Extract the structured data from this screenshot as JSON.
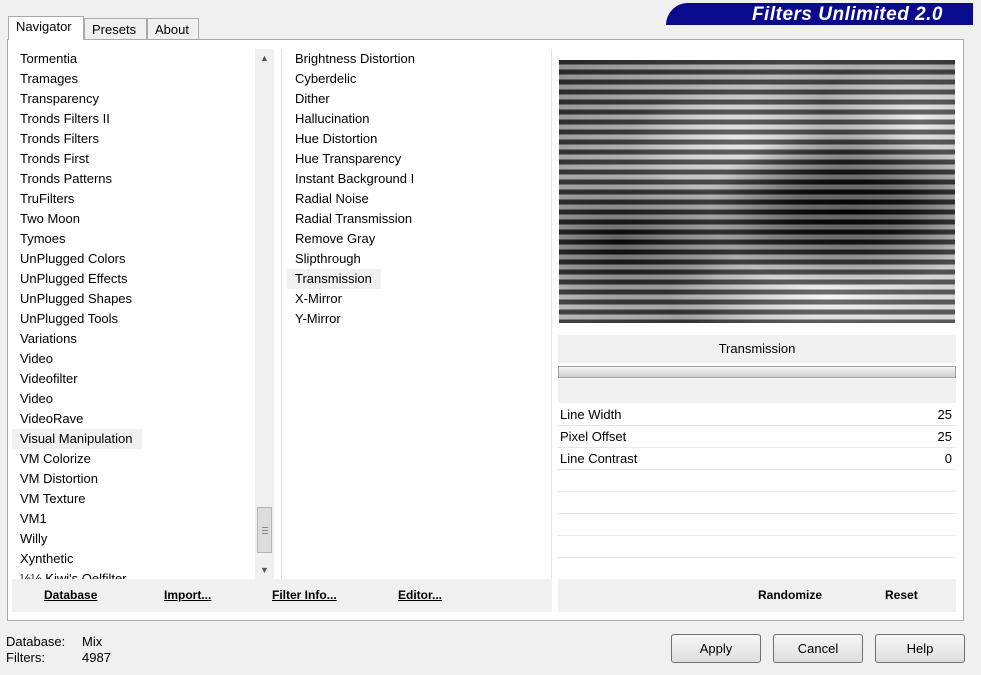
{
  "tabs": [
    {
      "label": "Navigator"
    },
    {
      "label": "Presets"
    },
    {
      "label": "About"
    }
  ],
  "logo": {
    "text": "Filters Unlimited 2.0"
  },
  "categories": {
    "items": [
      "Tormentia",
      "Tramages",
      "Transparency",
      "Tronds Filters II",
      "Tronds Filters",
      "Tronds First",
      "Tronds Patterns",
      "TruFilters",
      "Two Moon",
      "Tymoes",
      "UnPlugged Colors",
      "UnPlugged Effects",
      "UnPlugged Shapes",
      "UnPlugged Tools",
      "Variations",
      "Video",
      "Videofilter",
      "Video",
      "VideoRave",
      "Visual Manipulation",
      "VM Colorize",
      "VM Distortion",
      "VM Texture",
      "VM1",
      "Willy",
      "Xynthetic",
      "½½ Kiwi's Oelfilter"
    ],
    "selected": "Visual Manipulation"
  },
  "filters": {
    "items": [
      "Brightness Distortion",
      "Cyberdelic",
      "Dither",
      "Hallucination",
      "Hue Distortion",
      "Hue Transparency",
      "Instant Background I",
      "Radial Noise",
      "Radial Transmission",
      "Remove Gray",
      "Slipthrough",
      "Transmission",
      "X-Mirror",
      "Y-Mirror"
    ],
    "selected": "Transmission"
  },
  "preview": {
    "filter_name": "Transmission"
  },
  "params": [
    {
      "label": "Line Width",
      "value": "25"
    },
    {
      "label": "Pixel Offset",
      "value": "25"
    },
    {
      "label": "Line Contrast",
      "value": "0"
    }
  ],
  "left_bar": {
    "database": "Database",
    "import": "Import...",
    "filter_info": "Filter Info...",
    "editor": "Editor..."
  },
  "right_bar": {
    "randomize": "Randomize",
    "reset": "Reset"
  },
  "status": {
    "database_label": "Database:",
    "database_value": "Mix",
    "filters_label": "Filters:",
    "filters_value": "4987"
  },
  "buttons": {
    "apply": "Apply",
    "cancel": "Cancel",
    "help": "Help"
  }
}
